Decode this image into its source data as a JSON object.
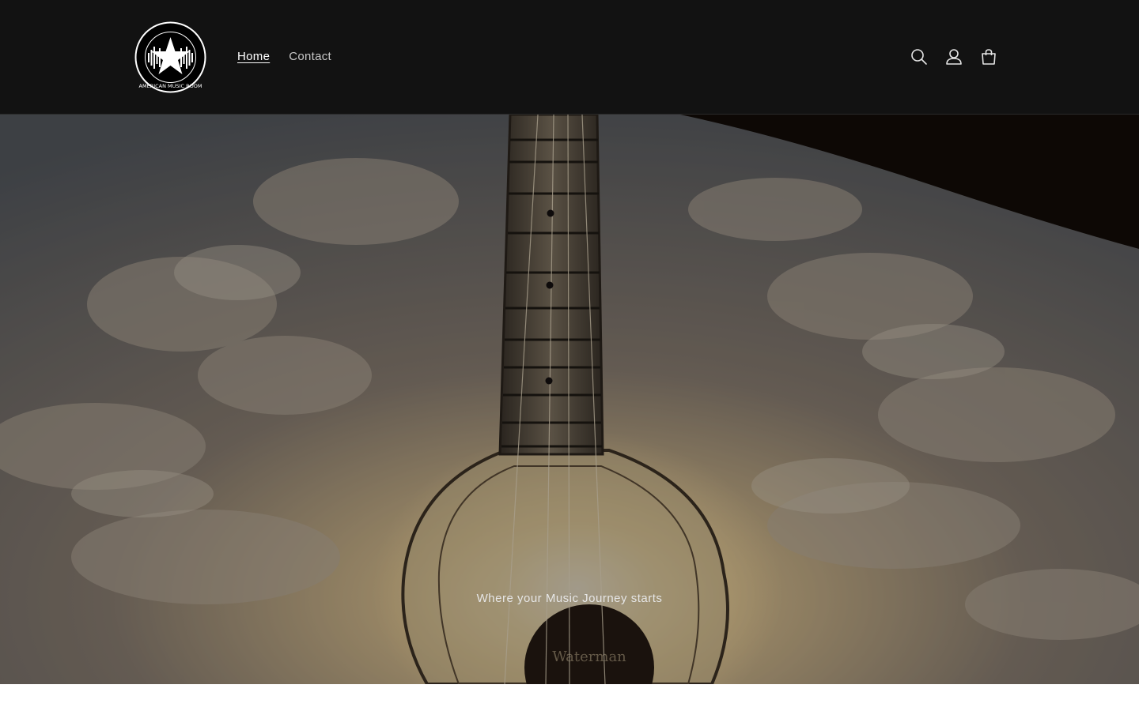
{
  "header": {
    "logo_text": "AMERICAN MUSIC ROOM",
    "nav": [
      {
        "label": "Home",
        "active": true
      },
      {
        "label": "Contact",
        "active": false
      }
    ],
    "icons": [
      "search-icon",
      "account-icon",
      "cart-icon"
    ]
  },
  "hero": {
    "tagline": "Where your Music Journey starts",
    "guitar_text": "Waterman"
  },
  "colors": {
    "header_bg": "#121212",
    "text": "#ffffff",
    "nav_inactive": "#c8c8c8"
  }
}
